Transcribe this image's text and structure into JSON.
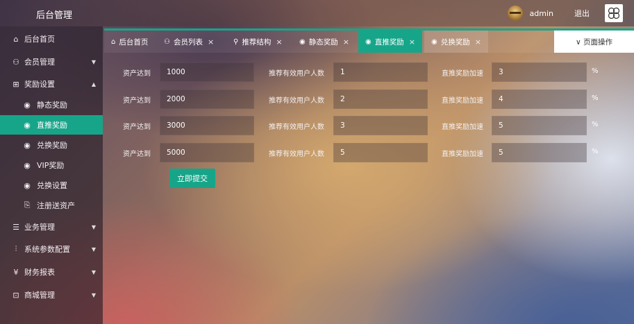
{
  "header": {
    "brand": "后台管理",
    "user": "admin",
    "logout": "退出"
  },
  "sidebar": {
    "items": [
      {
        "label": "后台首页",
        "icon": "home-icon",
        "glyph": "⌂"
      },
      {
        "label": "会员管理",
        "icon": "user-icon",
        "glyph": "⚇"
      },
      {
        "label": "奖励设置",
        "icon": "gift-icon",
        "glyph": "⊞"
      },
      {
        "label": "静态奖励",
        "icon": "radio-dot-icon",
        "glyph": "◉"
      },
      {
        "label": "直推奖励",
        "icon": "radio-dot-icon",
        "glyph": "◉"
      },
      {
        "label": "兑换奖励",
        "icon": "radio-dot-icon",
        "glyph": "◉"
      },
      {
        "label": "VIP奖励",
        "icon": "radio-dot-icon",
        "glyph": "◉"
      },
      {
        "label": "兑换设置",
        "icon": "radio-dot-icon",
        "glyph": "◉"
      },
      {
        "label": "注册送资产",
        "icon": "register-gift-icon",
        "glyph": "⎘"
      },
      {
        "label": "业务管理",
        "icon": "business-icon",
        "glyph": "☰"
      },
      {
        "label": "系统参数配置",
        "icon": "sliders-icon",
        "glyph": "⫶"
      },
      {
        "label": "财务报表",
        "icon": "finance-icon",
        "glyph": "¥"
      },
      {
        "label": "商城管理",
        "icon": "shop-icon",
        "glyph": "⊡"
      }
    ]
  },
  "tabs": [
    {
      "label": "后台首页",
      "icon": "home-icon",
      "glyph": "⌂",
      "close": ""
    },
    {
      "label": "会员列表",
      "icon": "user-icon",
      "glyph": "⚇",
      "close": "×"
    },
    {
      "label": "推荐结构",
      "icon": "structure-icon",
      "glyph": "⚲",
      "close": "×"
    },
    {
      "label": "静态奖励",
      "icon": "radio-dot-icon",
      "glyph": "◉",
      "close": "×"
    },
    {
      "label": "直推奖励",
      "icon": "radio-dot-icon",
      "glyph": "◉",
      "close": "×"
    },
    {
      "label": "兑换奖励",
      "icon": "radio-dot-icon",
      "glyph": "◉",
      "close": "×"
    }
  ],
  "page_ops": "∨ 页面操作",
  "form": {
    "label_assets": "资产达到",
    "label_referrals": "推荐有效用户人数",
    "label_speedup": "直推奖励加速",
    "pct": "%",
    "rows": [
      {
        "assets": "1000",
        "referrals": "1",
        "speedup": "3"
      },
      {
        "assets": "2000",
        "referrals": "2",
        "speedup": "4"
      },
      {
        "assets": "3000",
        "referrals": "3",
        "speedup": "5"
      },
      {
        "assets": "5000",
        "referrals": "5",
        "speedup": "5"
      }
    ],
    "submit": "立即提交"
  },
  "colors": {
    "accent": "#17a589"
  }
}
